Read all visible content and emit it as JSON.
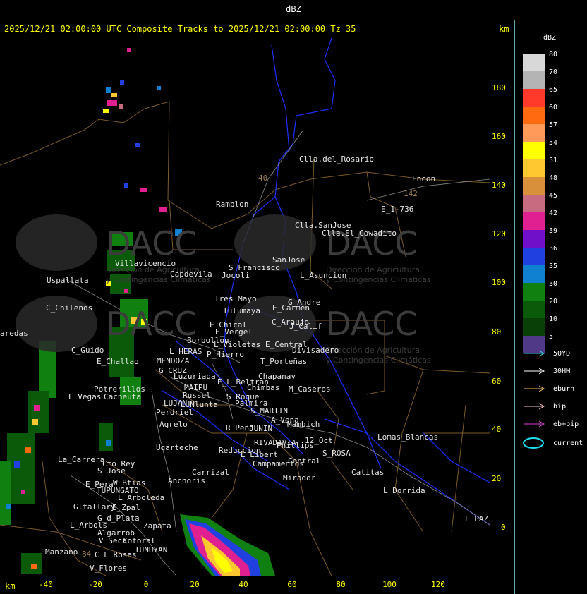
{
  "header": {
    "unit_label": "dBZ"
  },
  "title": "2025/12/21 02:00:00 UTC Composite Tracks to 2025/12/21 02:00:00 Tz 35",
  "axis_units": "km",
  "legend": {
    "title": "dBZ",
    "scale": [
      {
        "value": "80",
        "color": "#d8d8d8"
      },
      {
        "value": "70",
        "color": "#b4b4b4"
      },
      {
        "value": "65",
        "color": "#ff3a2a"
      },
      {
        "value": "60",
        "color": "#ff6a10"
      },
      {
        "value": "57",
        "color": "#ff9a5a"
      },
      {
        "value": "54",
        "color": "#ffff00"
      },
      {
        "value": "51",
        "color": "#ffc830"
      },
      {
        "value": "48",
        "color": "#d8903a"
      },
      {
        "value": "45",
        "color": "#c86a80"
      },
      {
        "value": "42",
        "color": "#e02090"
      },
      {
        "value": "39",
        "color": "#7010c8"
      },
      {
        "value": "36",
        "color": "#2040e0"
      },
      {
        "value": "35",
        "color": "#1080d0"
      },
      {
        "value": "30",
        "color": "#108010"
      },
      {
        "value": "20",
        "color": "#0a5a0a"
      },
      {
        "value": "10",
        "color": "#084008"
      },
      {
        "value": "5",
        "color": "#503a88"
      }
    ],
    "tracks": [
      {
        "label": "50YD",
        "color": "#40d0e0"
      },
      {
        "label": "30HM",
        "color": "#ffffff"
      },
      {
        "label": "eburn",
        "color": "#ffc060"
      },
      {
        "label": "bip",
        "color": "#ffc0c0"
      },
      {
        "label": "eb+bip",
        "color": "#e040e0"
      },
      {
        "label": "current",
        "color": "#20e0f0"
      }
    ]
  },
  "y_ticks": [
    "180",
    "160",
    "140",
    "120",
    "100",
    "80",
    "60",
    "40",
    "20",
    "0"
  ],
  "x_ticks": [
    "-40",
    "-20",
    "0",
    "20",
    "40",
    "60",
    "80",
    "100",
    "120"
  ],
  "watermark": {
    "brand": "DACC",
    "line1": "Dirección de Agricultura",
    "line2": "y Contingencias Climáticas"
  },
  "places": [
    "Clla.del_Rosario",
    "Encon",
    "142",
    "E_1-736",
    "Ramblon",
    "40",
    "Clla.SanJose",
    "Clla.El_Cowadito",
    "Villavicencio",
    "S_Francisco",
    "SanJose",
    "Capdevila",
    "Jocoli",
    "L_Asuncion",
    "Uspallata",
    "Tres_Mayo",
    "G_Andre",
    "C_Chilenos",
    "Tulumaya",
    "E_Carmen",
    "E_Chical",
    "C_Araujo",
    "J_Calif",
    "aredas",
    "E_Vergel",
    "Borbollon",
    "L_Violetas",
    "E_Central",
    "Divisadero",
    "C_Guido",
    "L_HERAS",
    "P_Hierro",
    "E_Challao",
    "MENDOZA",
    "T_Porteñas",
    "G_CRUZ",
    "Luzuriaga",
    "Chapanay",
    "E_L_Beltran",
    "MAIPU",
    "Chimbas",
    "M_Caseros",
    "Potrerillos",
    "Russel",
    "S_Roque",
    "L_Vegas",
    "Cacheuta",
    "LUJAN",
    "Palmira",
    "LUNlunta",
    "S_MARTIN",
    "Perdriel",
    "A_Vena",
    "Agrelo",
    "R_Peña",
    "JUNIN",
    "Mambich",
    "RIVADAVIA",
    "Phillips",
    "12_Oct",
    "Ugarteche",
    "Reduccion",
    "L_Libert",
    "S_ROSA",
    "Lomas_Blancas",
    "La_Carrera",
    "Cto_Rey",
    "S_Jose",
    "Carrizal",
    "Campamentos",
    "Central",
    "Catitas",
    "E_Pera",
    "W_Btias",
    "Anchoris",
    "Mirador",
    "TUPUNGATO",
    "L_Dorrida",
    "L_Arboleda",
    "Gltallary",
    "E_Zpal",
    "L_PAZ",
    "G_d_Plata",
    "L_Arbols",
    "Zapata",
    "Algarrob",
    "Manzano",
    "V_Seca",
    "Cotoral",
    "84",
    "TUNUYAN",
    "C_L_Rosas",
    "V_Flores"
  ]
}
